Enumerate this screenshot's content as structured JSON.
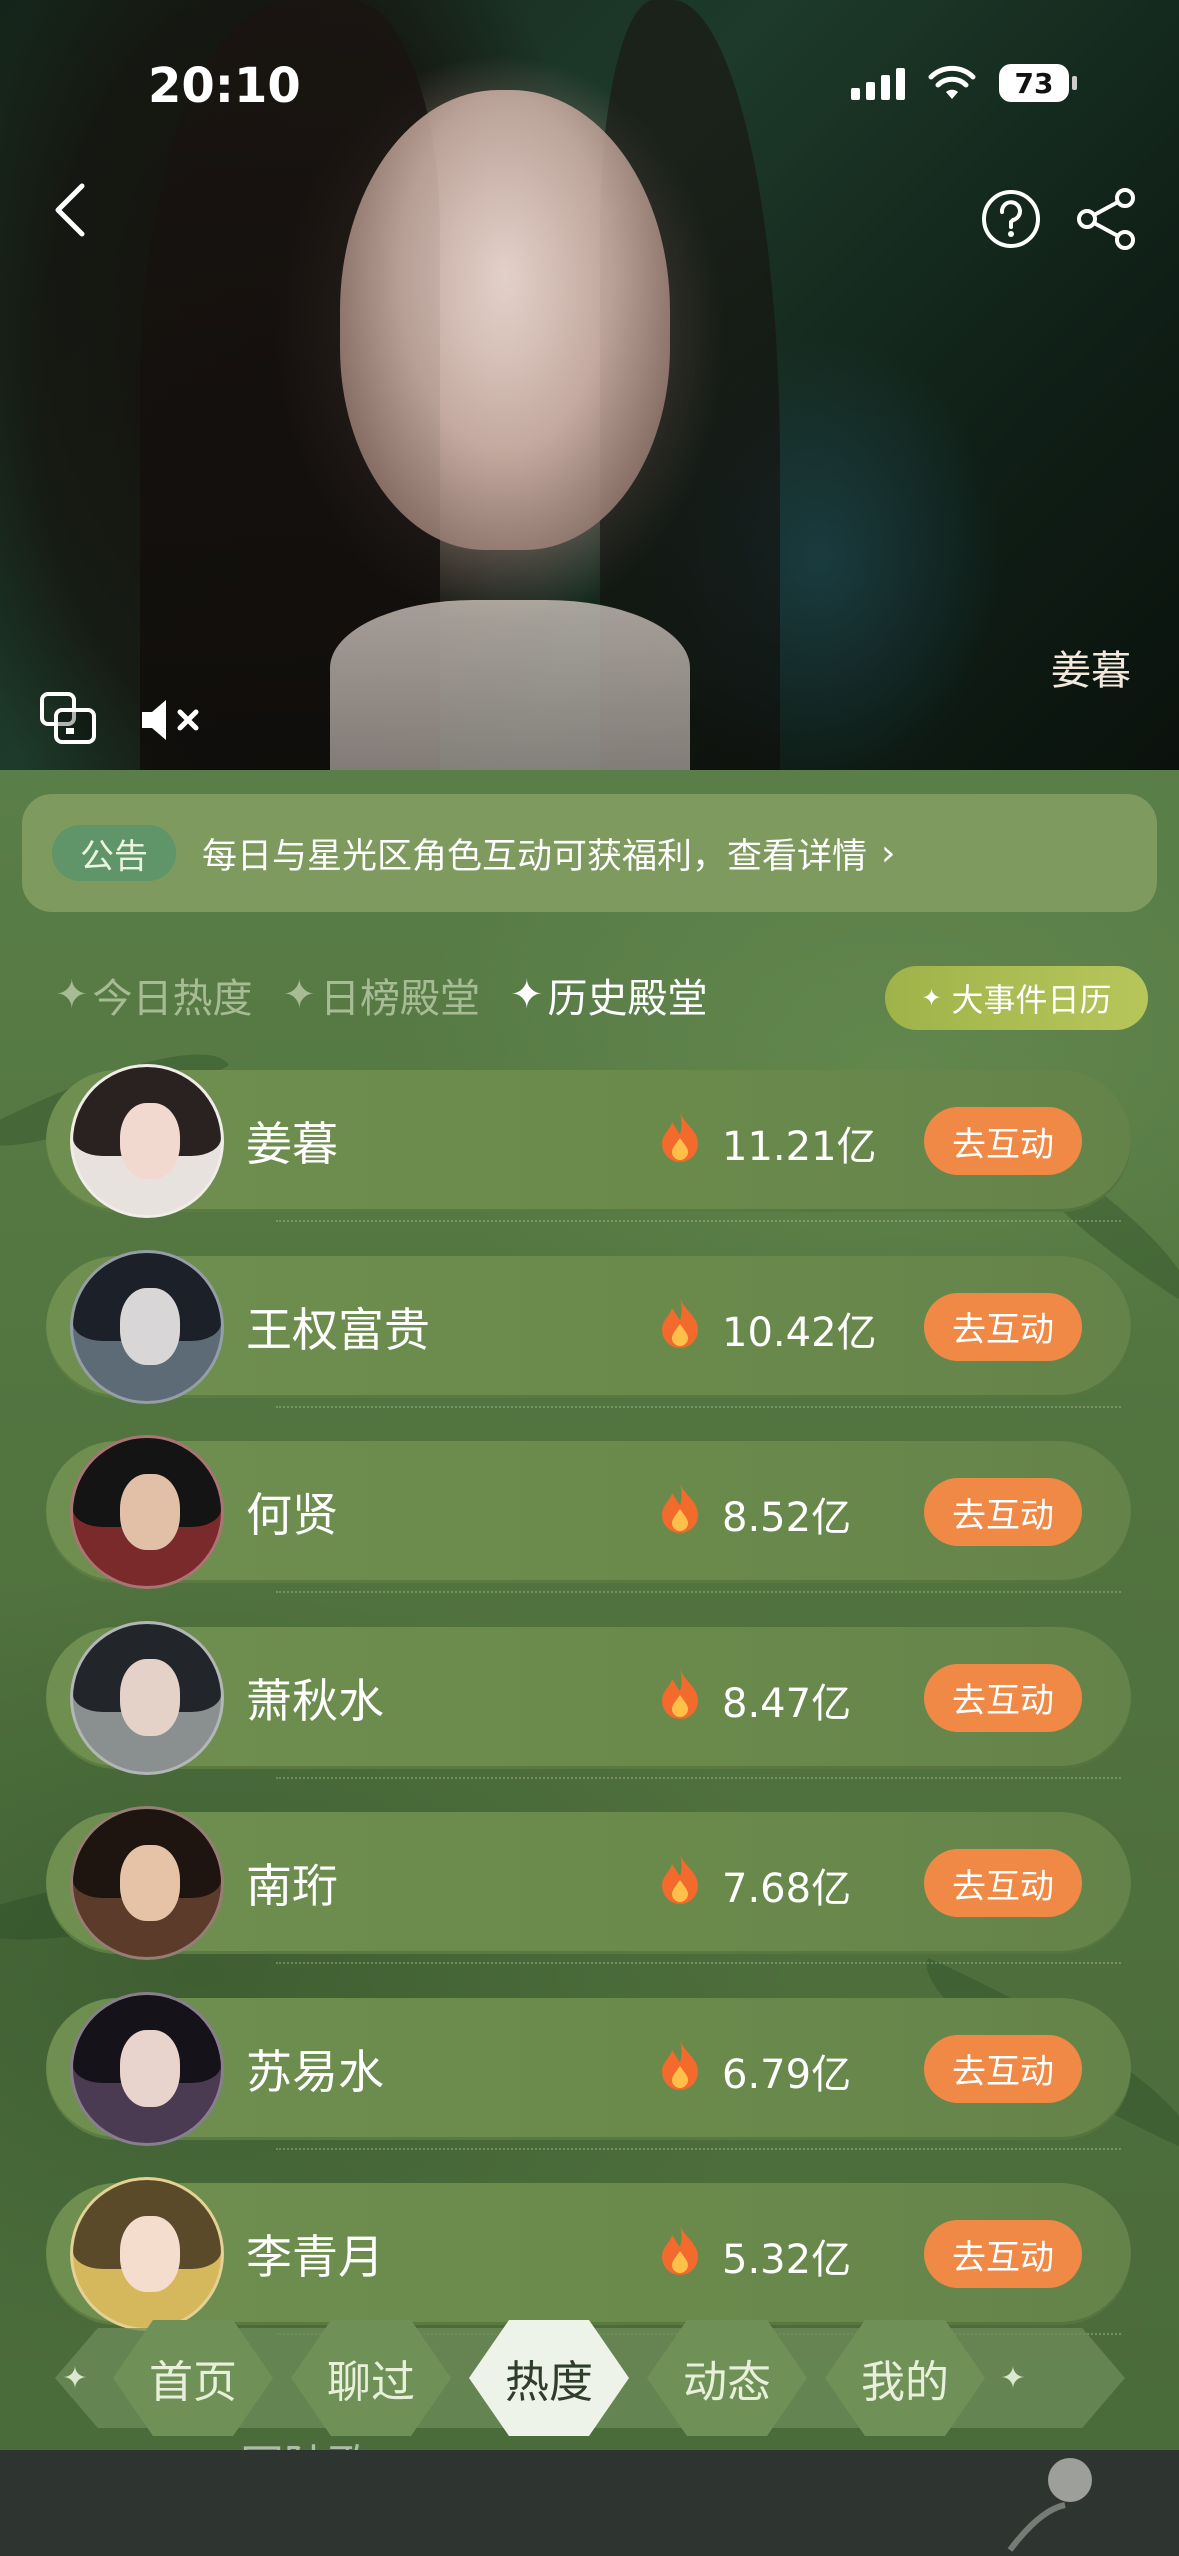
{
  "status_bar": {
    "time": "20:10",
    "battery": "73"
  },
  "hero": {
    "character_name": "姜暮"
  },
  "notice": {
    "badge": "公告",
    "text": "每日与星光区角色互动可获福利，查看详情"
  },
  "tabs": [
    {
      "label": "今日热度",
      "active": false
    },
    {
      "label": "日榜殿堂",
      "active": false
    },
    {
      "label": "历史殿堂",
      "active": true
    }
  ],
  "event_button": {
    "label": "大事件日历"
  },
  "ranking": [
    {
      "name": "姜暮",
      "score": "11.21亿",
      "action": "去互动",
      "avatar_bg": "#e8e2de",
      "hair": "#2a2220",
      "skin": "#f1d9cf"
    },
    {
      "name": "王权富贵",
      "score": "10.42亿",
      "action": "去互动",
      "avatar_bg": "#5d6b77",
      "hair": "#1c2028",
      "skin": "#d9d6d8"
    },
    {
      "name": "何贤",
      "score": "8.52亿",
      "action": "去互动",
      "avatar_bg": "#7a2a2a",
      "hair": "#141414",
      "skin": "#e2c0a8"
    },
    {
      "name": "萧秋水",
      "score": "8.47亿",
      "action": "去互动",
      "avatar_bg": "#8a9090",
      "hair": "#22262b",
      "skin": "#e4d2c8"
    },
    {
      "name": "南珩",
      "score": "7.68亿",
      "action": "去互动",
      "avatar_bg": "#5c3b2a",
      "hair": "#1e1410",
      "skin": "#e6c3a6"
    },
    {
      "name": "苏易水",
      "score": "6.79亿",
      "action": "去互动",
      "avatar_bg": "#4a3a52",
      "hair": "#16121a",
      "skin": "#e8d4cc"
    },
    {
      "name": "李青月",
      "score": "5.32亿",
      "action": "去互动",
      "avatar_bg": "#d6b85c",
      "hair": "#5a4a2a",
      "skin": "#f4ddcc"
    }
  ],
  "peek_row": {
    "name": "同陆歌"
  },
  "bottom_nav": [
    {
      "label": "首页",
      "active": false
    },
    {
      "label": "聊过",
      "active": false
    },
    {
      "label": "热度",
      "active": true
    },
    {
      "label": "动态",
      "active": false
    },
    {
      "label": "我的",
      "active": false
    }
  ],
  "colors": {
    "accent_orange": "#f08946",
    "panel_green": "#52743f",
    "event_yellow_green": "#b7c65b"
  }
}
